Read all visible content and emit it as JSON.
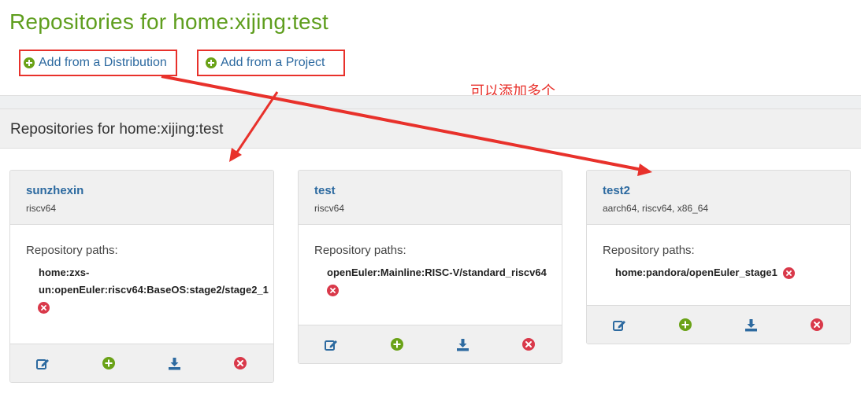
{
  "page": {
    "title": "Repositories for home:xijing:test"
  },
  "actions": {
    "add_distribution": "Add from a Distribution",
    "add_project": "Add from a Project"
  },
  "annotation": {
    "text": "可以添加多个"
  },
  "section": {
    "title": "Repositories for home:xijing:test"
  },
  "repositories": [
    {
      "name": "sunzhexin",
      "arch": "riscv64",
      "paths_label": "Repository paths:",
      "path_line1": "home:zxs-",
      "path_line2": "un:openEuler:riscv64:BaseOS:stage2/stage2_1"
    },
    {
      "name": "test",
      "arch": "riscv64",
      "paths_label": "Repository paths:",
      "path_line1": "openEuler:Mainline:RISC-V/standard_riscv64"
    },
    {
      "name": "test2",
      "arch": "aarch64, riscv64, x86_64",
      "paths_label": "Repository paths:",
      "path_line1": "home:pandora/openEuler_stage1"
    }
  ],
  "icons": {
    "edit": "edit-icon",
    "add": "plus-circle-icon",
    "download": "download-icon",
    "remove": "times-circle-icon"
  },
  "colors": {
    "title_green": "#5f9e1e",
    "link_blue": "#2d6aa0",
    "annotation_red": "#e8312b",
    "remove_red": "#d9394a"
  }
}
